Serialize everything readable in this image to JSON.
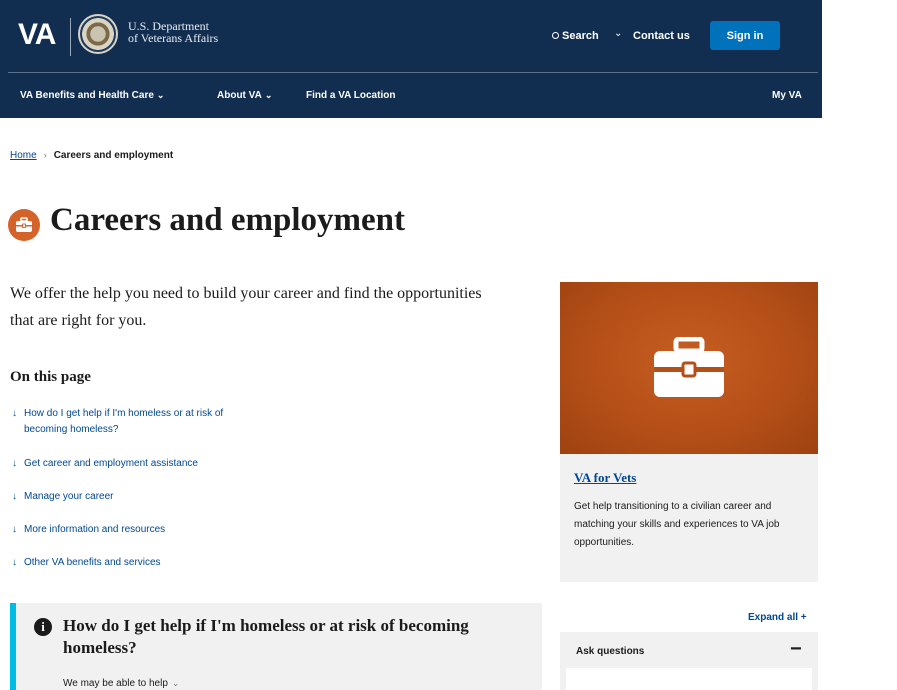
{
  "header": {
    "logo_text": "VA",
    "dept_line1": "U.S. Department",
    "dept_line2": "of Veterans Affairs",
    "search_label": "Search",
    "contact_label": "Contact us",
    "signin_label": "Sign in",
    "nav": {
      "benefits_label": "VA Benefits and Health Care",
      "about_label": "About VA",
      "find_label": "Find a VA Location",
      "myva_label": "My VA"
    }
  },
  "breadcrumb": {
    "home": "Home",
    "current": "Careers and employment"
  },
  "page": {
    "title": "Careers and employment",
    "intro": "We offer the help you need to build your career and find the opportunities that are right for you.",
    "on_this_page": "On this page",
    "toc": [
      {
        "label": "How do I get help if I'm homeless or at risk of becoming homeless?"
      },
      {
        "label": "Get career and employment assistance"
      },
      {
        "label": "Manage your career"
      },
      {
        "label": "More information and resources"
      },
      {
        "label": "Other VA benefits and services"
      }
    ]
  },
  "alert": {
    "title": "How do I get help if I'm homeless or at risk of becoming homeless?",
    "subtext": "We may be able to help"
  },
  "promo": {
    "link": "VA for Vets",
    "text": "Get help transitioning to a civilian career and matching your skills and experiences to VA job opportunities."
  },
  "sidebar": {
    "expand_all": "Expand all +",
    "accordion_label": "Ask questions",
    "accordion_toggle": "−"
  },
  "colors": {
    "header_bg": "#112e51",
    "signin_bg": "#0071bb",
    "accent_orange": "#d4632a",
    "link_blue": "#004795",
    "alert_border": "#00bde3"
  },
  "icons": {
    "search": "search-icon",
    "title": "briefcase-icon",
    "promo": "toolbox-icon",
    "alert": "info-icon"
  }
}
